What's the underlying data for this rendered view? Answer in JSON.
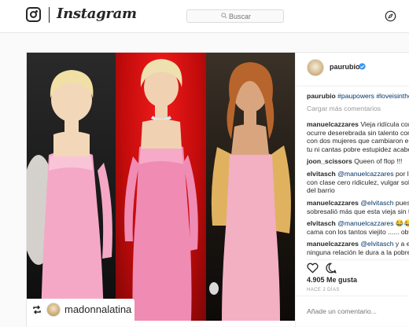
{
  "header": {
    "brand": "Instagram",
    "search": {
      "placeholder": "Buscar"
    },
    "icons": {
      "logo": "instagram-glyph-icon",
      "explore": "compass-icon"
    }
  },
  "post": {
    "author": "paurubio",
    "verified": true,
    "repost_badge": {
      "icon": "repost-icon",
      "account": "madonnalatina"
    },
    "photo": {
      "panels": [
        {
          "dress": "#f4a8c6",
          "bg": "#111111"
        },
        {
          "dress": "#f08bb3",
          "bg": "#d01414"
        },
        {
          "dress": "#f3b0c2",
          "bg": "#1a1510"
        }
      ]
    },
    "caption": {
      "user": "paurubio",
      "text": "#paupowers #loveisintheair #showmelove"
    },
    "load_more": "Cargar más comentarios",
    "comments": [
      {
        "user": "manuelcazzares",
        "lines": [
          "Vieja ridícula como se le",
          "ocurre deserebrada sin talento compararte",
          "con dos mujeres que cambiaron el mundo",
          "tu ni cantas pobre estupidez acabo de"
        ]
      },
      {
        "user": "joon_scissors",
        "lines": [
          "Queen of flop !!!"
        ]
      },
      {
        "user": "elvitasch",
        "mention": "@manuelcazzares",
        "lines": [
          "por lo menos",
          "con clase cero ridiculez, vulgar solo the",
          "del barrio"
        ]
      },
      {
        "user": "manuelcazzares",
        "mention": "@elvitasch",
        "lines": [
          "pues that",
          "sobresalió más que esta vieja sin talento"
        ]
      },
      {
        "user": "elvitasch",
        "mention": "@manuelcazzares",
        "emoji": "😂😂😂",
        "lines": [
          "",
          "cama con los tantos viejito ...... obvio"
        ]
      },
      {
        "user": "manuelcazzares",
        "mention": "@elvitasch",
        "lines": [
          "y a esta",
          "ninguna relación le dura a la pobre"
        ]
      }
    ],
    "likes": "4.905 Me gusta",
    "time_ago": "HACE 2 DÍAS",
    "add_comment": {
      "placeholder": "Añade un comentario..."
    },
    "icons": {
      "like": "heart-icon",
      "comment": "comment-bubble-icon",
      "verified": "verified-badge-icon"
    },
    "accent": "#3897f0",
    "link_color": "#003569"
  }
}
